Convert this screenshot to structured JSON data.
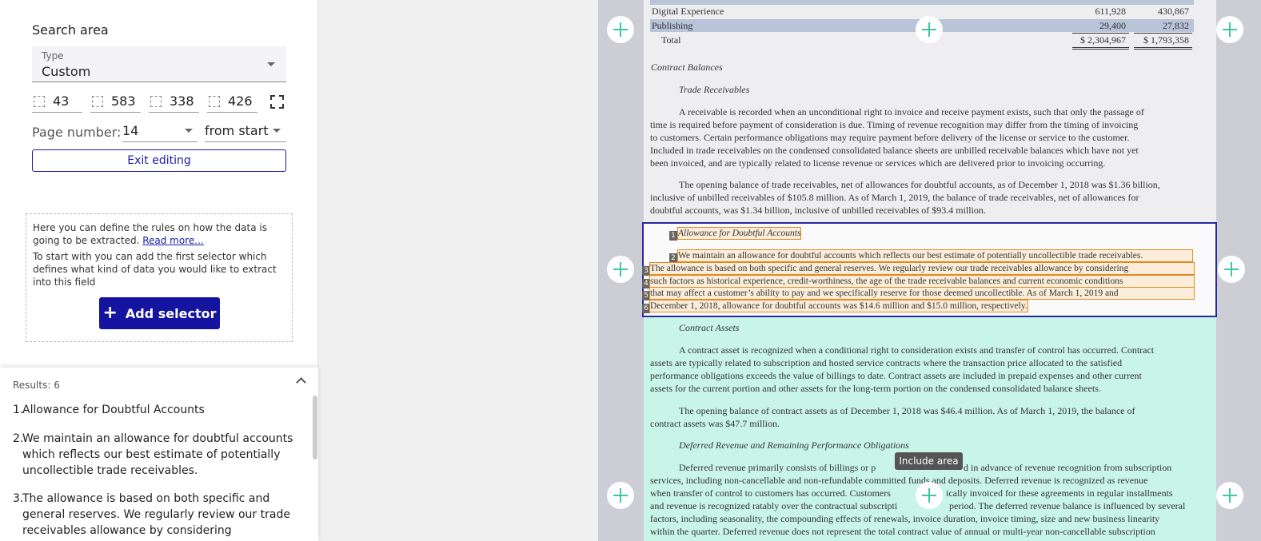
{
  "search_area": {
    "title": "Search area",
    "type_label": "Type",
    "type_value": "Custom",
    "coords": [
      "43",
      "583",
      "338",
      "426"
    ],
    "page_label": "Page number:",
    "page_value": "14",
    "page_from": "from start",
    "exit_label": "Exit editing"
  },
  "hint": {
    "text1": "Here you can define the rules on how the data is going to be extracted.",
    "read_more": "Read more...",
    "text2": "To start with you can add the first selector which defines what kind of data you would like to extract into this field",
    "add_selector": "Add selector",
    "add_icon": "+"
  },
  "results": {
    "title": "Results: 6",
    "items": [
      {
        "num": "1.",
        "text": "Allowance for Doubtful Accounts"
      },
      {
        "num": "2.",
        "text": "We maintain an allowance for doubtful accounts which reflects our best estimate of potentially uncollectible trade receivables."
      },
      {
        "num": "3.",
        "text": "The allowance is based on both specific and general reserves. We regularly review our trade receivables allowance by considering"
      }
    ]
  },
  "document": {
    "table_rows": [
      {
        "label": "Digital Experience",
        "v1": "611,928",
        "v2": "430,867"
      },
      {
        "label": "Publishing",
        "v1": "29,400",
        "v2": "27,832"
      },
      {
        "label": "Total",
        "v1": "$ 2,304,967",
        "v2": "$ 1,793,358"
      }
    ],
    "h_contract_balances": "Contract Balances",
    "h_trade_receivables": "Trade Receivables",
    "p1": [
      "A receivable is recorded when an unconditional right to invoice and receive payment exists, such that only the passage of",
      "time is required before payment of consideration is due. Timing of revenue recognition may differ from the timing of invoicing",
      "to customers. Certain performance obligations may require payment before delivery of the license or service to the customer.",
      "Included in trade receivables on the condensed consolidated balance sheets are unbilled receivable balances which have not yet",
      "been invoiced, and are typically related to license revenue or services which are delivered prior to invoicing occurring."
    ],
    "p2": [
      "The opening balance of trade receivables, net of allowances for doubtful accounts, as of December 1, 2018 was $1.36 billion,",
      "inclusive of unbilled receivables of $105.8 million. As of March 1, 2019, the balance of trade receivables, net of allowances for",
      "doubtful accounts, was $1.34 billion, inclusive of unbilled receivables of $93.4 million."
    ],
    "selected": [
      {
        "marker": "1",
        "text": "Allowance for Doubtful Accounts"
      },
      {
        "marker": "2",
        "text": "We maintain an allowance for doubtful accounts which reflects our best estimate of potentially uncollectible trade receivables."
      },
      {
        "marker": "3",
        "text": "The allowance is based on both specific and general reserves. We regularly review our trade receivables allowance by considering"
      },
      {
        "marker": "4",
        "text": "such factors as historical experience, credit-worthiness, the age of the trade receivable balances and current economic conditions"
      },
      {
        "marker": "5",
        "text": "that may affect a customer’s ability to pay and we specifically reserve for those deemed uncollectible. As of  March 1, 2019 and"
      },
      {
        "marker": "6",
        "text": "December 1, 2018, allowance for doubtful accounts was $14.6 million and $15.0 million, respectively."
      }
    ],
    "h_contract_assets": "Contract Assets",
    "p3": [
      "A contract asset is recognized when a conditional right to consideration exists and transfer of control has occurred. Contract",
      "assets are typically related to subscription and hosted service contracts where the transaction price allocated to the satisfied",
      "performance obligations exceeds the value of billings to date. Contract assets are included in prepaid expenses and other current",
      "assets for the current portion and other assets for the long-term portion on the condensed consolidated balance sheets."
    ],
    "p4": [
      "The opening balance of contract assets as of December 1, 2018 was $46.4 million. As of March 1, 2019, the balance of",
      "contract assets was $47.7 million."
    ],
    "h_deferred": "Deferred Revenue and Remaining Performance Obligations",
    "p5": [
      "Deferred revenue primarily consists of billings or p",
      "d in advance of revenue recognition from subscription",
      "services, including non-cancellable and non-refundable committed funds and deposits. Deferred revenue is recognized as revenue",
      "when transfer of control to customers has occurred. Customers",
      "ically invoiced for these agreements in regular installments",
      "and revenue is recognized ratably over the contractual subscripti",
      "period. The deferred revenue balance is influenced by several",
      "factors, including seasonality, the compounding effects of renewals, invoice duration, invoice timing, size and new business linearity",
      "within the quarter. Deferred revenue does not represent the total contract value of annual or multi-year non-cancellable subscription"
    ],
    "tooltip": "Include area"
  }
}
